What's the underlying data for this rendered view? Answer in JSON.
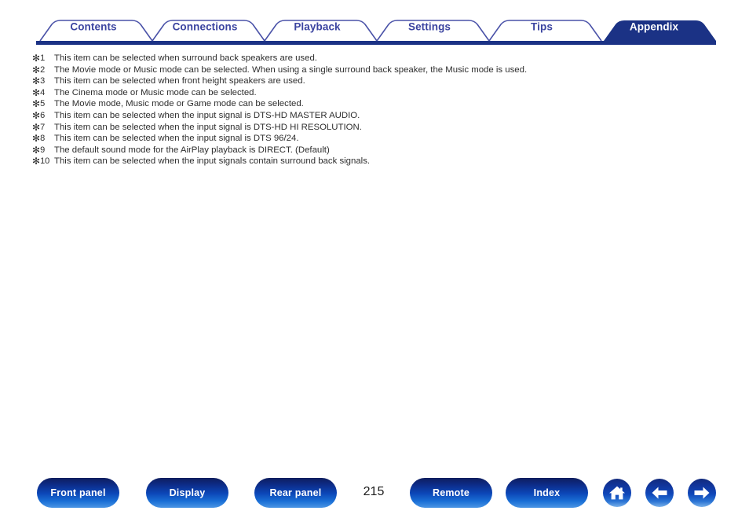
{
  "nav": {
    "tabs": [
      {
        "label": "Contents",
        "active": false
      },
      {
        "label": "Connections",
        "active": false
      },
      {
        "label": "Playback",
        "active": false
      },
      {
        "label": "Settings",
        "active": false
      },
      {
        "label": "Tips",
        "active": false
      },
      {
        "label": "Appendix",
        "active": true
      }
    ],
    "accent_color": "#3b44a0",
    "active_tab_fill": "#1b3285",
    "underline_color": "#1b3285"
  },
  "notes": [
    {
      "mark": "✻",
      "num": "1",
      "text": "This item can be selected when surround back speakers are used."
    },
    {
      "mark": "✻",
      "num": "2",
      "text": "The Movie mode or Music mode can be selected. When using a single surround back speaker, the Music mode is used."
    },
    {
      "mark": "✻",
      "num": "3",
      "text": "This item can be selected when front height speakers are used."
    },
    {
      "mark": "✻",
      "num": "4",
      "text": "The Cinema mode or Music mode can be selected."
    },
    {
      "mark": "✻",
      "num": "5",
      "text": "The Movie mode, Music mode or Game mode can be selected."
    },
    {
      "mark": "✻",
      "num": "6",
      "text": "This item can be selected when the input signal is DTS-HD MASTER AUDIO."
    },
    {
      "mark": "✻",
      "num": "7",
      "text": "This item can be selected when the input signal is DTS-HD HI RESOLUTION."
    },
    {
      "mark": "✻",
      "num": "8",
      "text": "This item can be selected when the input signal is DTS 96/24."
    },
    {
      "mark": "✻",
      "num": "9",
      "text": "The default sound mode for the AirPlay playback is DIRECT. (Default)"
    },
    {
      "mark": "✻",
      "num": "10",
      "text": "This item can be selected when the input signals contain surround back signals."
    }
  ],
  "footer": {
    "buttons": [
      {
        "label": "Front panel"
      },
      {
        "label": "Display"
      },
      {
        "label": "Rear panel"
      },
      {
        "label": "Remote"
      },
      {
        "label": "Index"
      }
    ],
    "page_number": "215",
    "icon_buttons": [
      {
        "icon": "home-icon"
      },
      {
        "icon": "arrow-left-icon"
      },
      {
        "icon": "arrow-right-icon"
      }
    ],
    "button_color": "#0c47b8"
  }
}
